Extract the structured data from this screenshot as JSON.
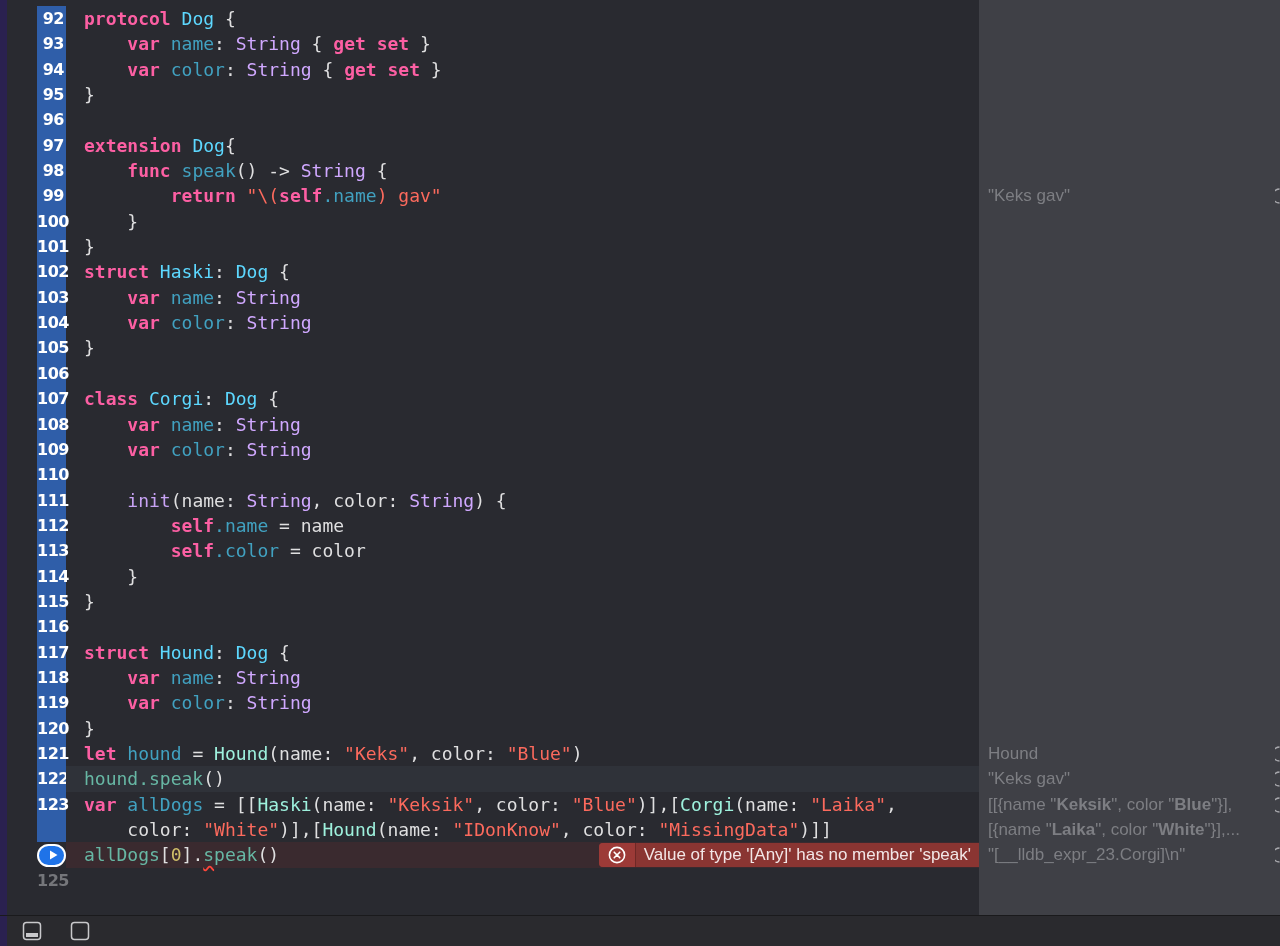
{
  "editor": {
    "lines": [
      {
        "number": "92",
        "kind": "numbered",
        "executed": true,
        "current": false,
        "tokens": [
          {
            "kind": "keyword",
            "text": "protocol "
          },
          {
            "kind": "type-decl",
            "text": "Dog"
          },
          {
            "kind": "plain",
            "text": " {"
          }
        ]
      },
      {
        "number": "93",
        "kind": "numbered",
        "executed": true,
        "current": false,
        "tokens": [
          {
            "kind": "keyword",
            "text": "    var "
          },
          {
            "kind": "ident-decl",
            "text": "name"
          },
          {
            "kind": "plain",
            "text": ": "
          },
          {
            "kind": "type-system",
            "text": "String"
          },
          {
            "kind": "plain",
            "text": " { "
          },
          {
            "kind": "keyword",
            "text": "get set"
          },
          {
            "kind": "plain",
            "text": " }"
          }
        ]
      },
      {
        "number": "94",
        "kind": "numbered",
        "executed": true,
        "current": false,
        "tokens": [
          {
            "kind": "keyword",
            "text": "    var "
          },
          {
            "kind": "ident-decl",
            "text": "color"
          },
          {
            "kind": "plain",
            "text": ": "
          },
          {
            "kind": "type-system",
            "text": "String"
          },
          {
            "kind": "plain",
            "text": " { "
          },
          {
            "kind": "keyword",
            "text": "get set"
          },
          {
            "kind": "plain",
            "text": " }"
          }
        ]
      },
      {
        "number": "95",
        "kind": "numbered",
        "executed": true,
        "current": false,
        "tokens": [
          {
            "kind": "plain",
            "text": "}"
          }
        ]
      },
      {
        "number": "96",
        "kind": "numbered",
        "executed": true,
        "current": false
      },
      {
        "number": "97",
        "kind": "numbered",
        "executed": true,
        "current": false,
        "tokens": [
          {
            "kind": "keyword",
            "text": "extension "
          },
          {
            "kind": "type-decl",
            "text": "Dog"
          },
          {
            "kind": "plain",
            "text": "{"
          }
        ]
      },
      {
        "number": "98",
        "kind": "numbered",
        "executed": true,
        "current": false,
        "tokens": [
          {
            "kind": "keyword",
            "text": "    func "
          },
          {
            "kind": "ident-decl",
            "text": "speak"
          },
          {
            "kind": "plain",
            "text": "() -> "
          },
          {
            "kind": "type-system",
            "text": "String"
          },
          {
            "kind": "plain",
            "text": " {"
          }
        ]
      },
      {
        "number": "99",
        "kind": "numbered",
        "executed": true,
        "current": false,
        "tokens": [
          {
            "kind": "keyword",
            "text": "        return "
          },
          {
            "kind": "string",
            "text": "\"\\("
          },
          {
            "kind": "keyword",
            "text": "self"
          },
          {
            "kind": "ident-decl",
            "text": ".name"
          },
          {
            "kind": "string",
            "text": ") gav\""
          }
        ],
        "results": [
          "\"Keks gav\""
        ]
      },
      {
        "number": "100",
        "kind": "numbered",
        "executed": true,
        "current": false,
        "tokens": [
          {
            "kind": "plain",
            "text": "    }"
          }
        ]
      },
      {
        "number": "101",
        "kind": "numbered",
        "executed": true,
        "current": false,
        "tokens": [
          {
            "kind": "plain",
            "text": "}"
          }
        ]
      },
      {
        "number": "102",
        "kind": "numbered",
        "executed": true,
        "current": false,
        "tokens": [
          {
            "kind": "keyword",
            "text": "struct "
          },
          {
            "kind": "type-decl",
            "text": "Haski"
          },
          {
            "kind": "plain",
            "text": ": "
          },
          {
            "kind": "type-decl",
            "text": "Dog"
          },
          {
            "kind": "plain",
            "text": " {"
          }
        ]
      },
      {
        "number": "103",
        "kind": "numbered",
        "executed": true,
        "current": false,
        "tokens": [
          {
            "kind": "keyword",
            "text": "    var "
          },
          {
            "kind": "ident-decl",
            "text": "name"
          },
          {
            "kind": "plain",
            "text": ": "
          },
          {
            "kind": "type-system",
            "text": "String"
          }
        ]
      },
      {
        "number": "104",
        "kind": "numbered",
        "executed": true,
        "current": false,
        "tokens": [
          {
            "kind": "keyword",
            "text": "    var "
          },
          {
            "kind": "ident-decl",
            "text": "color"
          },
          {
            "kind": "plain",
            "text": ": "
          },
          {
            "kind": "type-system",
            "text": "String"
          }
        ]
      },
      {
        "number": "105",
        "kind": "numbered",
        "executed": true,
        "current": false,
        "tokens": [
          {
            "kind": "plain",
            "text": "}"
          }
        ]
      },
      {
        "number": "106",
        "kind": "numbered",
        "executed": true,
        "current": false
      },
      {
        "number": "107",
        "kind": "numbered",
        "executed": true,
        "current": false,
        "tokens": [
          {
            "kind": "keyword",
            "text": "class "
          },
          {
            "kind": "type-decl",
            "text": "Corgi"
          },
          {
            "kind": "plain",
            "text": ": "
          },
          {
            "kind": "type-decl",
            "text": "Dog"
          },
          {
            "kind": "plain",
            "text": " {"
          }
        ]
      },
      {
        "number": "108",
        "kind": "numbered",
        "executed": true,
        "current": false,
        "tokens": [
          {
            "kind": "keyword",
            "text": "    var "
          },
          {
            "kind": "ident-decl",
            "text": "name"
          },
          {
            "kind": "plain",
            "text": ": "
          },
          {
            "kind": "type-system",
            "text": "String"
          }
        ]
      },
      {
        "number": "109",
        "kind": "numbered",
        "executed": true,
        "current": false,
        "tokens": [
          {
            "kind": "keyword",
            "text": "    var "
          },
          {
            "kind": "ident-decl",
            "text": "color"
          },
          {
            "kind": "plain",
            "text": ": "
          },
          {
            "kind": "type-system",
            "text": "String"
          }
        ]
      },
      {
        "number": "110",
        "kind": "numbered",
        "executed": true,
        "current": false
      },
      {
        "number": "111",
        "kind": "numbered",
        "executed": true,
        "current": false,
        "tokens": [
          {
            "kind": "other-decl",
            "text": "    init"
          },
          {
            "kind": "plain",
            "text": "(name: "
          },
          {
            "kind": "type-system",
            "text": "String"
          },
          {
            "kind": "plain",
            "text": ", color: "
          },
          {
            "kind": "type-system",
            "text": "String"
          },
          {
            "kind": "plain",
            "text": ") {"
          }
        ]
      },
      {
        "number": "112",
        "kind": "numbered",
        "executed": true,
        "current": false,
        "tokens": [
          {
            "kind": "keyword",
            "text": "        self"
          },
          {
            "kind": "ident-decl",
            "text": ".name"
          },
          {
            "kind": "plain",
            "text": " = name"
          }
        ]
      },
      {
        "number": "113",
        "kind": "numbered",
        "executed": true,
        "current": false,
        "tokens": [
          {
            "kind": "keyword",
            "text": "        self"
          },
          {
            "kind": "ident-decl",
            "text": ".color"
          },
          {
            "kind": "plain",
            "text": " = color"
          }
        ]
      },
      {
        "number": "114",
        "kind": "numbered",
        "executed": true,
        "current": false,
        "tokens": [
          {
            "kind": "plain",
            "text": "    }"
          }
        ]
      },
      {
        "number": "115",
        "kind": "numbered",
        "executed": true,
        "current": false,
        "tokens": [
          {
            "kind": "plain",
            "text": "}"
          }
        ]
      },
      {
        "number": "116",
        "kind": "numbered",
        "executed": true,
        "current": false
      },
      {
        "number": "117",
        "kind": "numbered",
        "executed": true,
        "current": false,
        "tokens": [
          {
            "kind": "keyword",
            "text": "struct "
          },
          {
            "kind": "type-decl",
            "text": "Hound"
          },
          {
            "kind": "plain",
            "text": ": "
          },
          {
            "kind": "type-decl",
            "text": "Dog"
          },
          {
            "kind": "plain",
            "text": " {"
          }
        ]
      },
      {
        "number": "118",
        "kind": "numbered",
        "executed": true,
        "current": false,
        "tokens": [
          {
            "kind": "keyword",
            "text": "    var "
          },
          {
            "kind": "ident-decl",
            "text": "name"
          },
          {
            "kind": "plain",
            "text": ": "
          },
          {
            "kind": "type-system",
            "text": "String"
          }
        ]
      },
      {
        "number": "119",
        "kind": "numbered",
        "executed": true,
        "current": false,
        "tokens": [
          {
            "kind": "keyword",
            "text": "    var "
          },
          {
            "kind": "ident-decl",
            "text": "color"
          },
          {
            "kind": "plain",
            "text": ": "
          },
          {
            "kind": "type-system",
            "text": "String"
          }
        ]
      },
      {
        "number": "120",
        "kind": "numbered",
        "executed": true,
        "current": false,
        "tokens": [
          {
            "kind": "plain",
            "text": "}"
          }
        ]
      },
      {
        "number": "121",
        "kind": "numbered",
        "executed": true,
        "current": false,
        "tokens": [
          {
            "kind": "keyword",
            "text": "let "
          },
          {
            "kind": "ident-decl",
            "text": "hound"
          },
          {
            "kind": "plain",
            "text": " = "
          },
          {
            "kind": "type-project",
            "text": "Hound"
          },
          {
            "kind": "plain",
            "text": "(name: "
          },
          {
            "kind": "string",
            "text": "\"Keks\""
          },
          {
            "kind": "plain",
            "text": ", color: "
          },
          {
            "kind": "string",
            "text": "\"Blue\""
          },
          {
            "kind": "plain",
            "text": ")"
          }
        ],
        "results": [
          "Hound"
        ]
      },
      {
        "number": "122",
        "kind": "numbered",
        "executed": true,
        "current": true,
        "tokens": [
          {
            "kind": "ident-project",
            "text": "hound.speak"
          },
          {
            "kind": "plain",
            "text": "()"
          }
        ],
        "results": [
          "\"Keks gav\""
        ]
      },
      {
        "number": "123",
        "kind": "numbered",
        "executed": true,
        "current": false,
        "tokens": [
          {
            "kind": "keyword",
            "text": "var "
          },
          {
            "kind": "ident-decl",
            "text": "allDogs"
          },
          {
            "kind": "plain",
            "text": " = [["
          },
          {
            "kind": "type-project",
            "text": "Haski"
          },
          {
            "kind": "plain",
            "text": "(name: "
          },
          {
            "kind": "string",
            "text": "\"Keksik\""
          },
          {
            "kind": "plain",
            "text": ", color: "
          },
          {
            "kind": "string",
            "text": "\"Blue\""
          },
          {
            "kind": "plain",
            "text": ")],["
          },
          {
            "kind": "type-project",
            "text": "Corgi"
          },
          {
            "kind": "plain",
            "text": "(name: "
          },
          {
            "kind": "string",
            "text": "\"Laika\""
          },
          {
            "kind": "plain",
            "text": ","
          }
        ],
        "wrapped_tokens": [
          {
            "kind": "plain",
            "text": "    color: "
          },
          {
            "kind": "string",
            "text": "\"White\""
          },
          {
            "kind": "plain",
            "text": ")],["
          },
          {
            "kind": "type-project",
            "text": "Hound"
          },
          {
            "kind": "plain",
            "text": "(name: "
          },
          {
            "kind": "string",
            "text": "\"IDonKnow\""
          },
          {
            "kind": "plain",
            "text": ", color: "
          },
          {
            "kind": "string",
            "text": "\"MissingData\""
          },
          {
            "kind": "plain",
            "text": ")]]"
          }
        ],
        "results": [
          "[[{name \"**Keksik**\", color \"**Blue**\"}],",
          "[{name \"**Laika**\", color \"**White**\"}],..."
        ]
      },
      {
        "kind": "run",
        "executed": false,
        "current": false,
        "tokens": [
          {
            "kind": "ident-project",
            "text": "allDogs"
          },
          {
            "kind": "plain",
            "text": "["
          },
          {
            "kind": "number",
            "text": "0"
          },
          {
            "kind": "plain",
            "text": "]."
          },
          {
            "kind": "error-underline",
            "text": "s"
          },
          {
            "kind": "ident-project",
            "text": "peak"
          },
          {
            "kind": "plain",
            "text": "()"
          }
        ],
        "error": {
          "message": "Value of type '[Any]' has no member 'speak'"
        },
        "results": [
          "\"[__lldb_expr_23.Corgi]\\n\""
        ]
      },
      {
        "number": "125",
        "kind": "numbered",
        "executed": false,
        "current": false
      }
    ]
  }
}
